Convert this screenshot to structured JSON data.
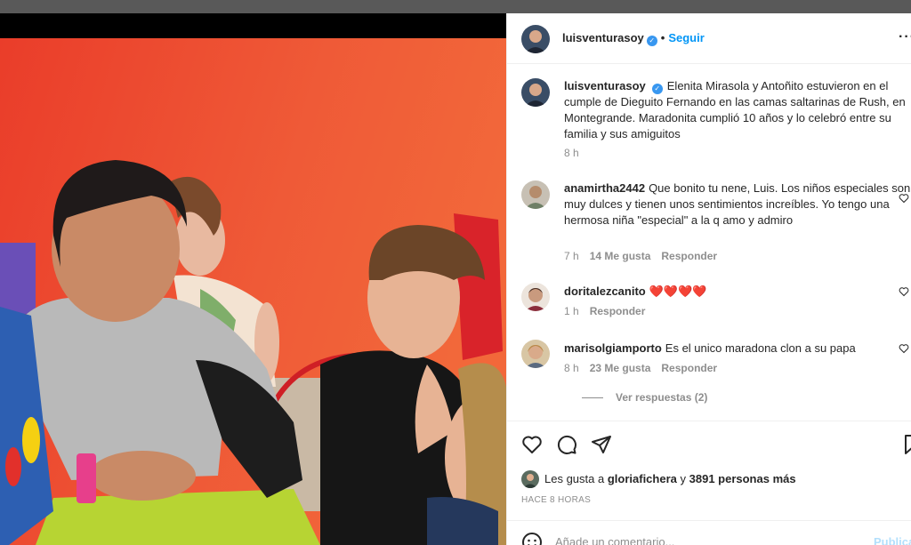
{
  "post": {
    "author": "luisventurasoy",
    "follow_label": "Seguir",
    "dot": "•",
    "more": "···",
    "verified_mark": "✓"
  },
  "caption": {
    "author": "luisventurasoy",
    "text": "Elenita Mirasola y Antoñito estuvieron en el cumple de Dieguito Fernando en las camas saltarinas de Rush, en Montegrande. Maradonita cumplió 10 años y lo celebró entre su familia y sus amiguitos",
    "time": "8 h"
  },
  "comments": [
    {
      "user": "anamirtha2442",
      "text": "Que bonito tu nene, Luis. Los niños especiales son muy dulces y tienen unos sentimientos increíbles. Yo tengo una hermosa niña \"especial\" a la q amo y admiro",
      "time": "7 h",
      "likes": "14 Me gusta",
      "reply": "Responder"
    },
    {
      "user": "doritalezcanito",
      "text": "❤️❤️❤️❤️",
      "time": "1 h",
      "reply": "Responder"
    },
    {
      "user": "marisolgiamporto",
      "text": "Es el unico maradona clon a su papa",
      "time": "8 h",
      "likes": "23 Me gusta",
      "reply": "Responder",
      "view_replies": "Ver respuestas (2)"
    }
  ],
  "likes_line": {
    "prefix": "Les gusta a",
    "user": "gloriafichera",
    "connector": "y",
    "others": "3891 personas más"
  },
  "time_ago": "HACE 8 HORAS",
  "add_comment": {
    "placeholder": "Añade un comentario...",
    "publish": "Publicar"
  },
  "icons": [
    "heart-icon",
    "comment-icon",
    "share-icon",
    "bookmark-icon",
    "emoji-icon",
    "more-options-icon",
    "verified-badge-icon"
  ],
  "colors": {
    "link_blue": "#0095f6",
    "verified_blue": "#3897f0",
    "muted_text": "#8e8e8e",
    "wall_orange": "#e8482f"
  }
}
